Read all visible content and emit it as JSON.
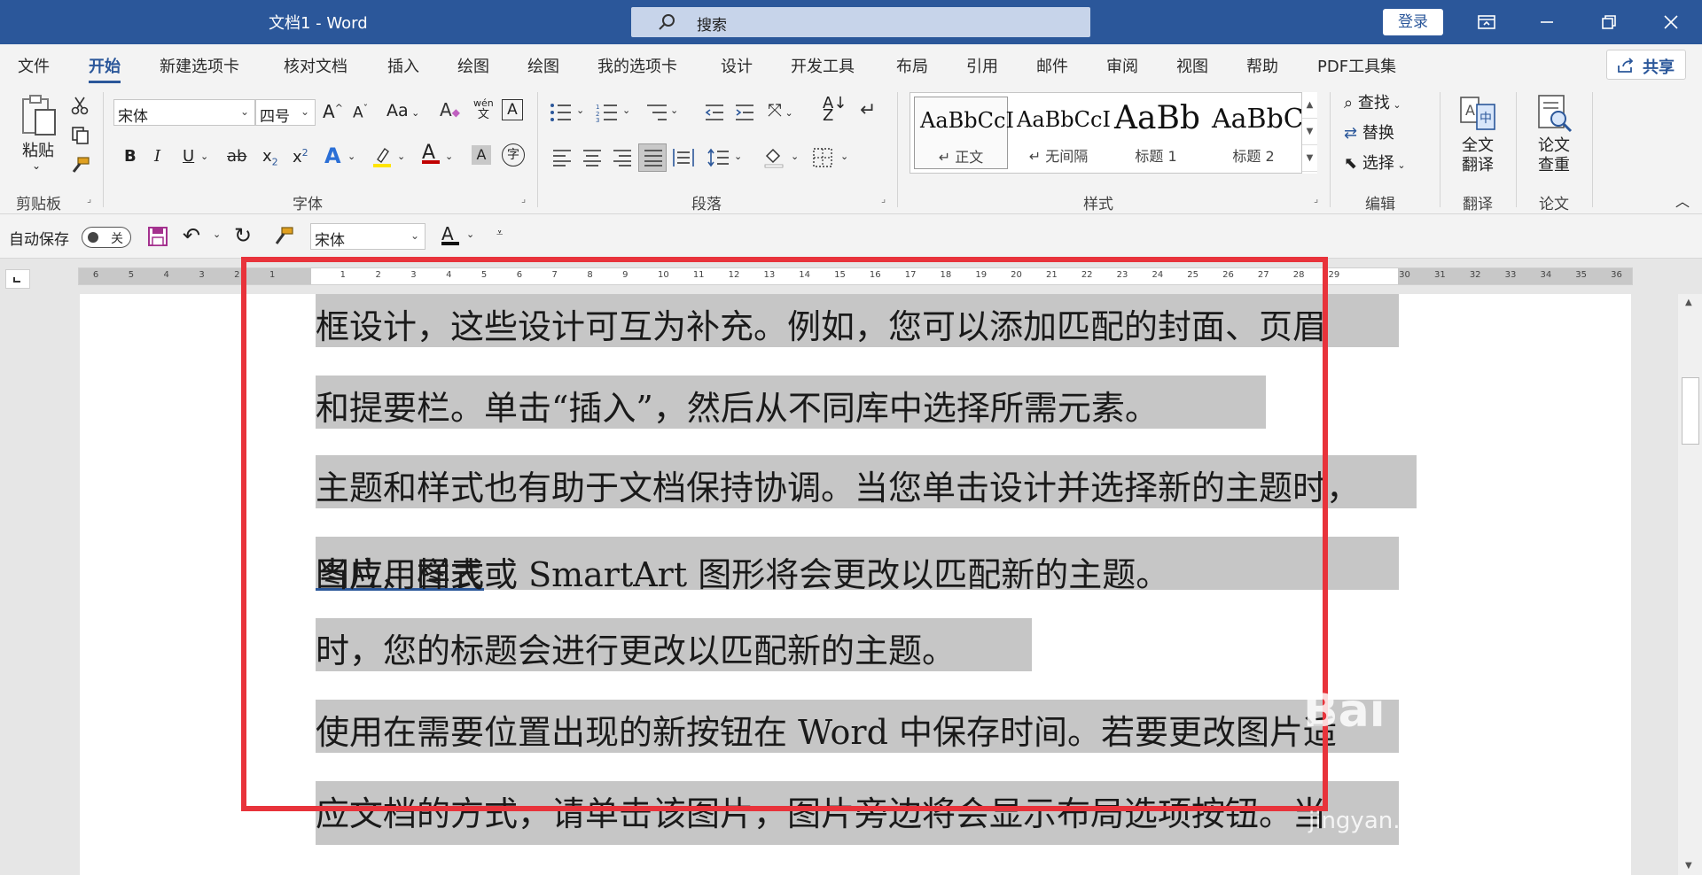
{
  "window": {
    "title": "文档1  -  Word",
    "login_label": "登录"
  },
  "search": {
    "placeholder": "搜索"
  },
  "tabs": [
    {
      "label": "文件"
    },
    {
      "label": "开始"
    },
    {
      "label": "新建选项卡"
    },
    {
      "label": "核对文档"
    },
    {
      "label": "插入"
    },
    {
      "label": "绘图"
    },
    {
      "label": "绘图"
    },
    {
      "label": "我的选项卡"
    },
    {
      "label": "设计"
    },
    {
      "label": "开发工具"
    },
    {
      "label": "布局"
    },
    {
      "label": "引用"
    },
    {
      "label": "邮件"
    },
    {
      "label": "审阅"
    },
    {
      "label": "视图"
    },
    {
      "label": "帮助"
    },
    {
      "label": "PDF工具集"
    }
  ],
  "share_label": "共享",
  "clipboard": {
    "paste_label": "粘贴",
    "group_label": "剪贴板"
  },
  "font": {
    "name": "宋体",
    "size": "四号",
    "group_label": "字体",
    "grow": "A",
    "shrink": "A",
    "case": "Aa",
    "phonetic_top": "wén",
    "phonetic_bottom": "文",
    "bold": "B",
    "italic": "I",
    "underline": "U",
    "strike": "ab",
    "subscript": "x",
    "superscript": "x",
    "sub2": "2",
    "sup2": "2"
  },
  "paragraph": {
    "group_label": "段落"
  },
  "styles": {
    "group_label": "样式",
    "items": [
      {
        "sample": "AaBbCcI",
        "name": "↵ 正文"
      },
      {
        "sample": "AaBbCcI",
        "name": "↵ 无间隔"
      },
      {
        "sample": "AaBb",
        "name": "标题 1"
      },
      {
        "sample": "AaBbC",
        "name": "标题 2"
      }
    ]
  },
  "editing": {
    "find": "查找",
    "replace": "替换",
    "select": "选择",
    "group_label": "编辑"
  },
  "translate": {
    "label_line1": "全文",
    "label_line2": "翻译",
    "group_label": "翻译"
  },
  "thesis": {
    "label_line1": "论文",
    "label_line2": "查重",
    "group_label": "论文"
  },
  "qat": {
    "autosave_label": "自动保存",
    "toggle_state": "关",
    "font_name": "宋体"
  },
  "ruler": {
    "numbers": [
      "6",
      "5",
      "4",
      "3",
      "2",
      "1",
      "",
      "1",
      "2",
      "3",
      "4",
      "5",
      "6",
      "7",
      "8",
      "9",
      "10",
      "11",
      "12",
      "13",
      "14",
      "15",
      "16",
      "17",
      "18",
      "19",
      "20",
      "21",
      "22",
      "23",
      "24",
      "25",
      "26",
      "27",
      "28",
      "29",
      "",
      "30",
      "31",
      "32",
      "33",
      "34",
      "35",
      "36"
    ]
  },
  "document": {
    "lines": [
      "框设计，这些设计可互为补充。例如，您可以添加匹配的封面、页眉",
      "和提要栏。单击“插入”，然后从不同库中选择所需元素。",
      "主题和样式也有助于文档保持协调。当您单击设计并选择新的主题时，",
      "图片、图表或 SmartArt 图形将会更改以匹配新的主题。",
      "时，您的标题会进行更改以匹配新的主题。",
      "使用在需要位置出现的新按钮在 Word 中保存时间。若要更改图片适",
      "应文档的方式，请单击该图片，图片旁边将会显示布局选项按钮。当"
    ],
    "line4_link": "当应用样式"
  },
  "watermark": {
    "brand": "Bai 经验",
    "url": "jingyan.baidu.com"
  }
}
